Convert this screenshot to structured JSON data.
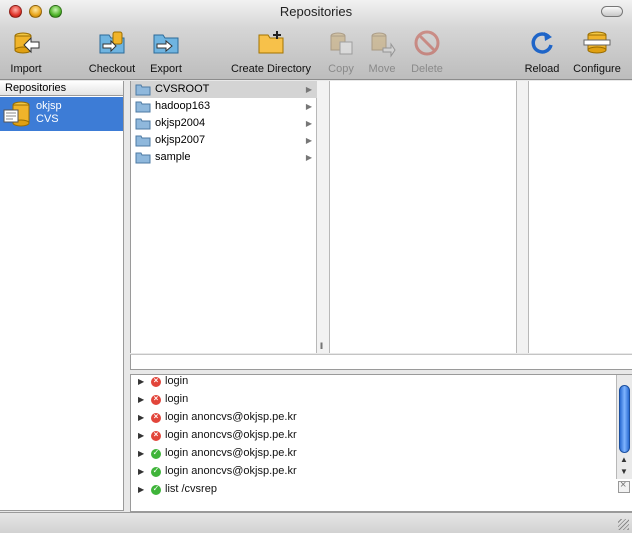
{
  "window": {
    "title": "Repositories"
  },
  "toolbar": {
    "import": "Import",
    "checkout": "Checkout",
    "export": "Export",
    "create_directory": "Create Directory",
    "copy": "Copy",
    "move": "Move",
    "delete": "Delete",
    "reload": "Reload",
    "configure": "Configure"
  },
  "sidebar": {
    "header": "Repositories",
    "items": [
      {
        "name": "okjsp",
        "type": "CVS"
      }
    ]
  },
  "browser": {
    "directories": [
      {
        "name": "CVSROOT",
        "selected": true
      },
      {
        "name": "hadoop163"
      },
      {
        "name": "okjsp2004"
      },
      {
        "name": "okjsp2007"
      },
      {
        "name": "sample"
      }
    ],
    "column_handle": "ll"
  },
  "log": {
    "entries": [
      {
        "status": "error",
        "text": "login"
      },
      {
        "status": "error",
        "text": "login"
      },
      {
        "status": "error",
        "text": "login anoncvs@okjsp.pe.kr"
      },
      {
        "status": "error",
        "text": "login anoncvs@okjsp.pe.kr"
      },
      {
        "status": "ok",
        "text": "login anoncvs@okjsp.pe.kr"
      },
      {
        "status": "ok",
        "text": "login anoncvs@okjsp.pe.kr"
      },
      {
        "status": "ok",
        "text": "list /cvsrep"
      }
    ]
  },
  "colors": {
    "selection": "#3d7cd6",
    "error": "#e2453a",
    "ok": "#3fb43a"
  }
}
